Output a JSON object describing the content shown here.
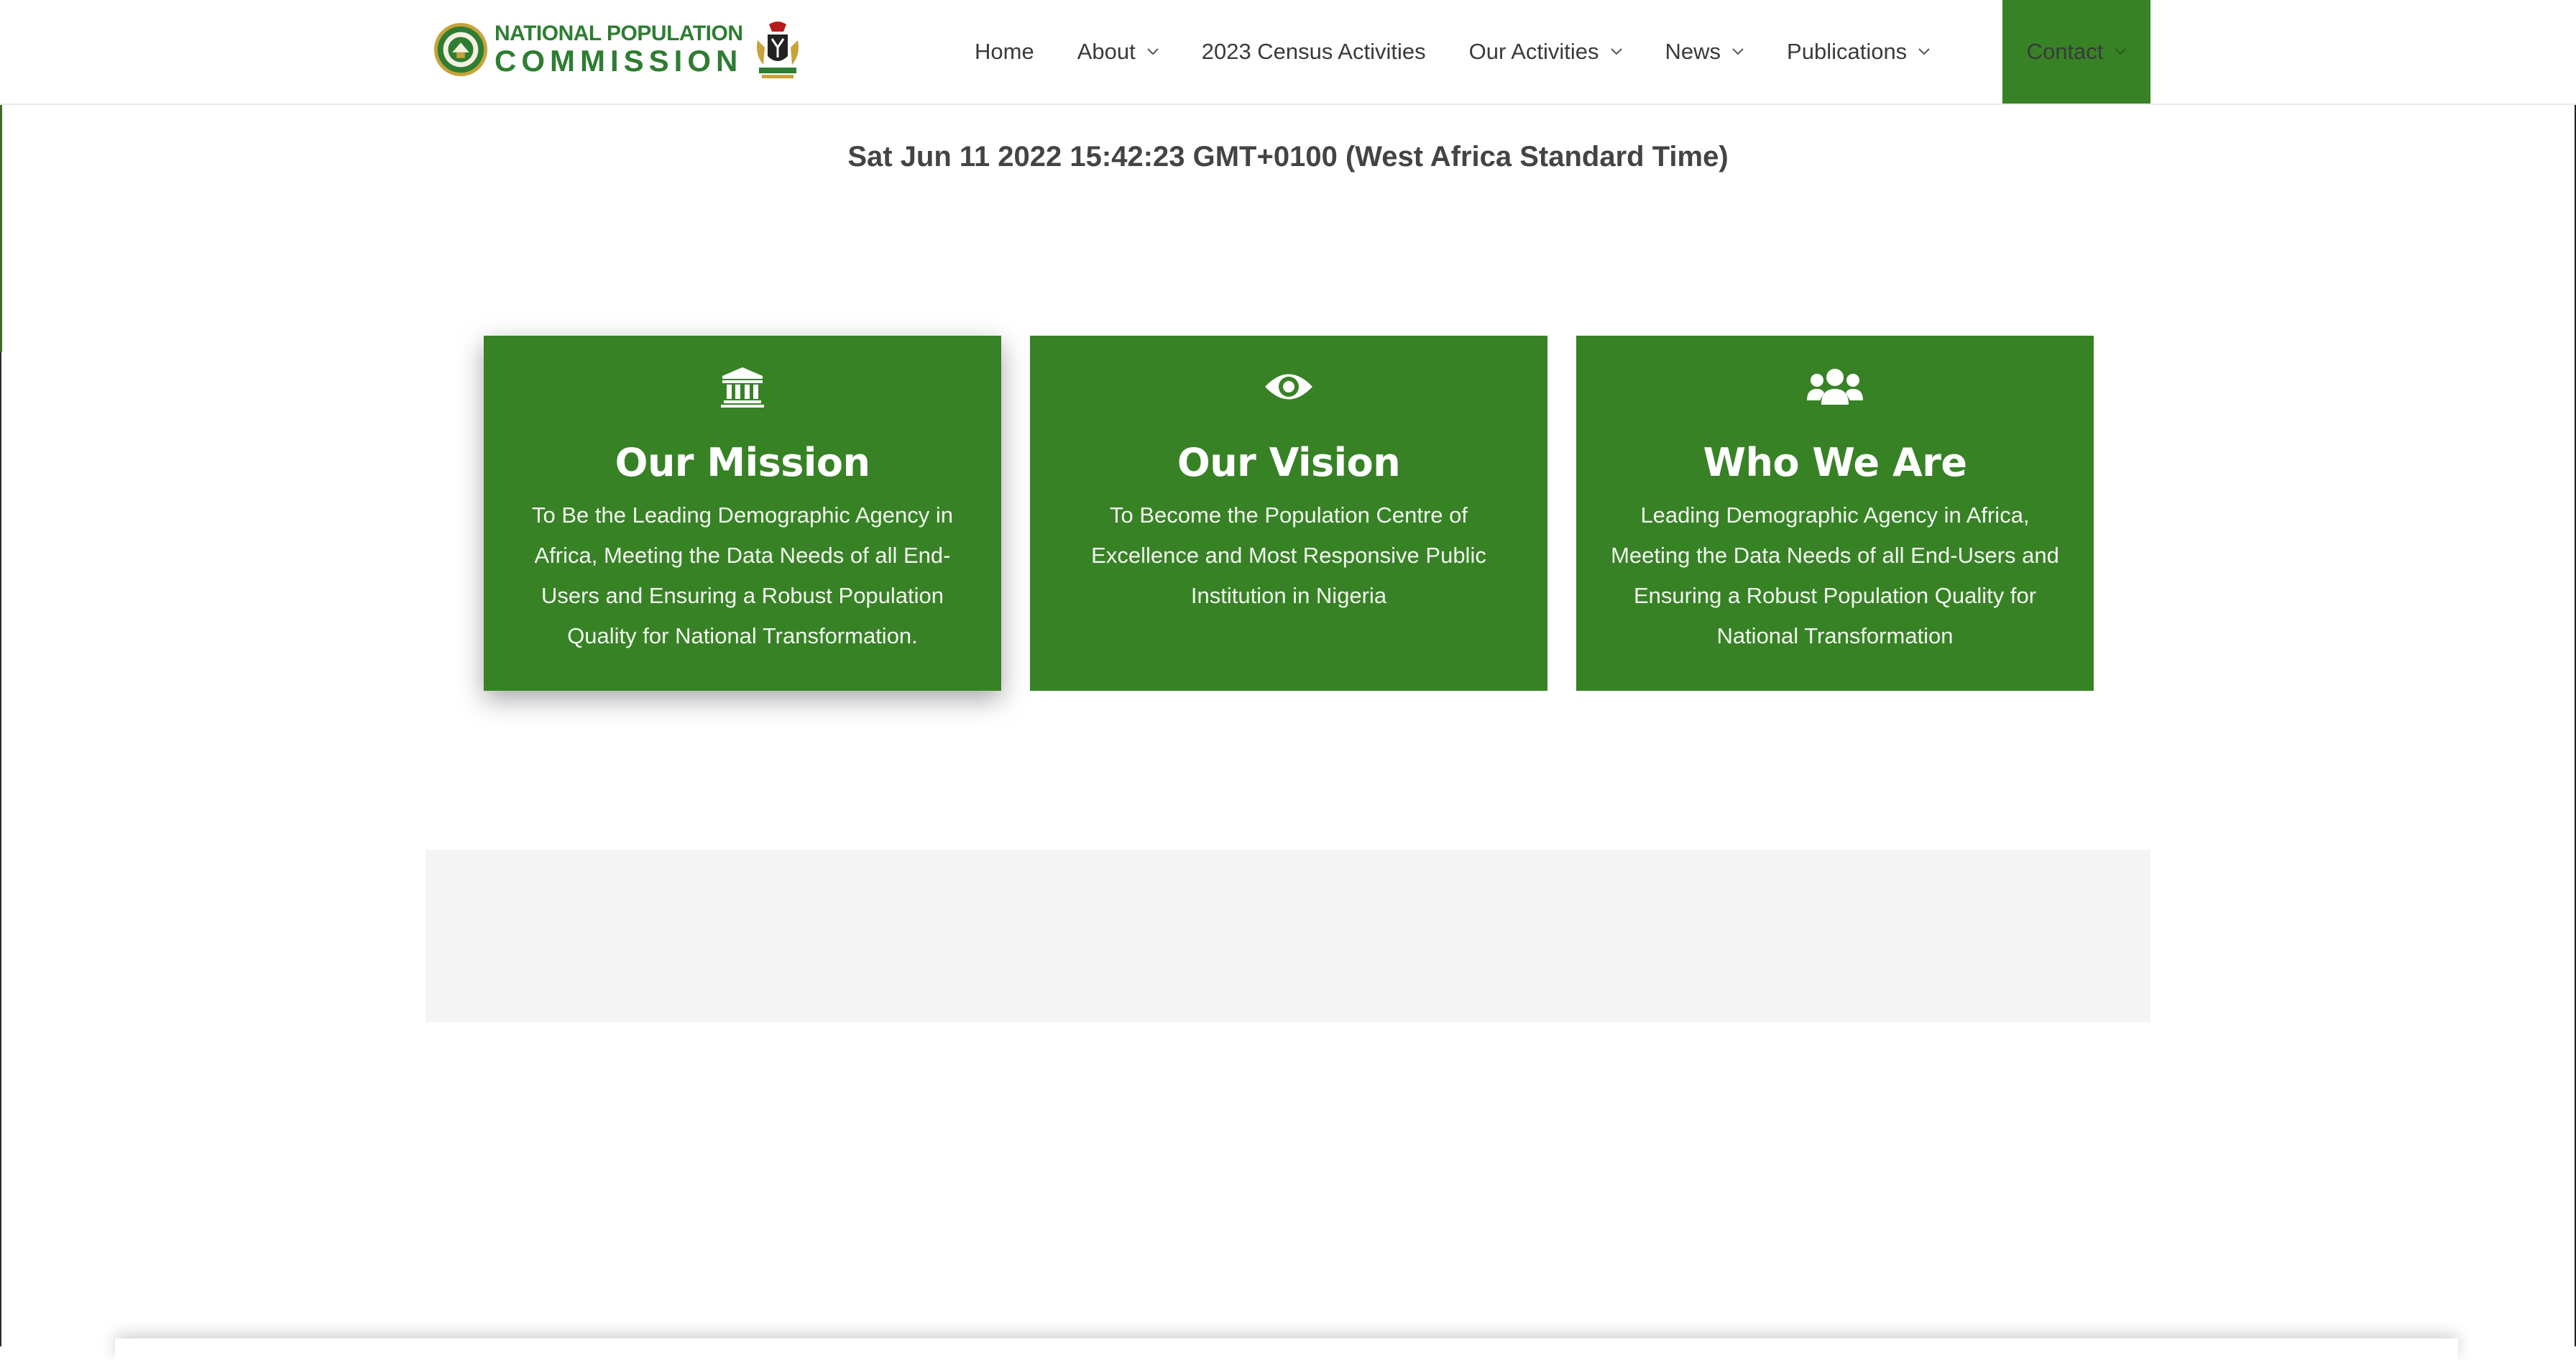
{
  "header": {
    "logo_line1": "NATIONAL POPULATION",
    "logo_line2": "COMMISSION",
    "nav": [
      {
        "label": "Home"
      },
      {
        "label": "About"
      },
      {
        "label": "2023 Census Activities"
      },
      {
        "label": "Our Activities"
      },
      {
        "label": "News"
      },
      {
        "label": "Publications"
      },
      {
        "label": "Contact"
      }
    ]
  },
  "datetime": "Sat Jun 11 2022 15:42:23 GMT+0100 (West Africa Standard Time)",
  "cards": [
    {
      "icon": "institution-icon",
      "title": "Our Mission",
      "text": "To Be the Leading Demographic Agency in Africa, Meeting the Data Needs of all End-Users and Ensuring a Robust Population Quality for National Transformation."
    },
    {
      "icon": "eye-icon",
      "title": "Our Vision",
      "text": "To Become the Population Centre of Excellence and Most Responsive Public Institution in Nigeria"
    },
    {
      "icon": "users-icon",
      "title": "Who We Are",
      "text": "Leading Demographic Agency in Africa, Meeting the Data Needs of all End-Users and Ensuring a Robust Population Quality for National Transformation"
    }
  ],
  "colors": {
    "brand_green": "#378225",
    "logo_green": "#2e7d32",
    "band_grey": "#f4f4f4"
  }
}
